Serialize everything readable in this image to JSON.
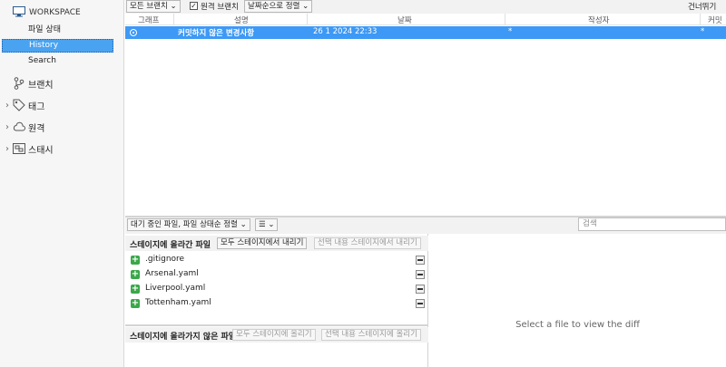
{
  "sidebar": {
    "workspace_label": "WORKSPACE",
    "workspace_items": [
      {
        "label": "파일 상태"
      },
      {
        "label": "History"
      },
      {
        "label": "Search"
      }
    ],
    "groups": [
      {
        "label": "브랜치",
        "icon": "branch-icon"
      },
      {
        "label": "태그",
        "icon": "tag-icon"
      },
      {
        "label": "원격",
        "icon": "cloud-icon"
      },
      {
        "label": "스태시",
        "icon": "stash-icon"
      }
    ]
  },
  "toolbar": {
    "branches_dropdown": "모든 브랜치",
    "remote_branches_label": "원격 브랜치",
    "remote_branches_checked": true,
    "sort_dropdown": "날짜순으로 정렬",
    "skip_label": "건너뛰기"
  },
  "columns": {
    "graph": "그래프",
    "description": "설명",
    "date": "날짜",
    "author": "작성자",
    "commit": "커밋"
  },
  "commit_row": {
    "description": "커밋하지 않은 변경사항",
    "date": "26 1 2024 22:33",
    "author": "*",
    "commit": "*"
  },
  "bottom_toolbar": {
    "filter_dropdown": "대기 중인 파일, 파일 상태순 정렬",
    "view_icon": "list-icon",
    "search_placeholder": "검색"
  },
  "staged": {
    "title": "스테이지에 올라간 파일",
    "unstage_all": "모두 스테이지에서 내리기",
    "unstage_selected": "선택 내용 스테이지에서 내리기",
    "files": [
      {
        "name": ".gitignore"
      },
      {
        "name": "Arsenal.yaml"
      },
      {
        "name": "Liverpool.yaml"
      },
      {
        "name": "Tottenham.yaml"
      }
    ]
  },
  "unstaged": {
    "title": "스테이지에 올라가지 않은 파일",
    "stage_all": "모두 스테이지에 올리기",
    "stage_selected": "선택 내용 스테이지에 올리기"
  },
  "diff": {
    "message": "Select a file to view the diff"
  },
  "colors": {
    "accent": "#3d99f5",
    "selection": "#4aa3f0",
    "added": "#3aa84a"
  }
}
